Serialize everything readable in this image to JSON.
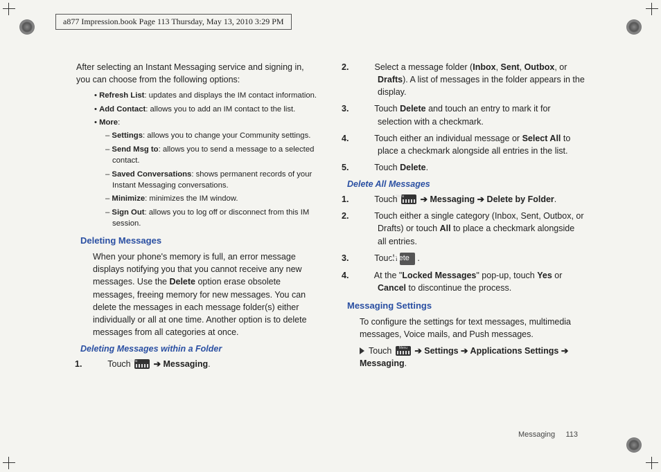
{
  "header": {
    "line": "a877 Impression.book  Page 113  Thursday, May 13, 2010  3:29 PM"
  },
  "footer": {
    "section": "Messaging",
    "page": "113"
  },
  "intro": "After selecting an Instant Messaging service and signing in, you can choose from the following options:",
  "bullets": {
    "refresh_b": "Refresh List",
    "refresh_t": ": updates and displays the IM contact information.",
    "addc_b": "Add Contact",
    "addc_t": ": allows you to add an IM contact to the list.",
    "more_b": "More",
    "more_t": ":"
  },
  "dashes": {
    "settings_b": "Settings",
    "settings_t": ": allows you to change your Community settings.",
    "sendmsg_b": "Send Msg to",
    "sendmsg_t": ": allows you to send a message to a selected contact.",
    "saved_b": "Saved Conversations",
    "saved_t": ": shows permanent records of your Instant Messaging conversations.",
    "min_b": "Minimize",
    "min_t": ": minimizes the IM window.",
    "signout_b": "Sign Out",
    "signout_t": ": allows you to log off or disconnect from this IM session."
  },
  "delmsg": {
    "h": "Deleting Messages",
    "p": "When your phone's memory is full, an error message displays notifying you that you cannot receive any new messages. Use the ",
    "p_b": "Delete",
    "p2": " option erase obsolete messages, freeing memory for new messages. You can delete the messages in each message folder(s) either individually or all at one time. Another option is to delete messages from all categories at once."
  },
  "delfolder": {
    "h": "Deleting Messages within a Folder",
    "s1a": "Touch ",
    "s1b": "Messaging",
    "s1c": ".",
    "s2a": "Select a message folder (",
    "s2b": "Inbox",
    "s2c": ", ",
    "s2d": "Sent",
    "s2e": ", ",
    "s2f": "Outbox",
    "s2g": ", or ",
    "s2h": "Drafts",
    "s2i": "). A list of messages in the folder appears in the display.",
    "s3a": "Touch ",
    "s3b": "Delete",
    "s3c": " and touch an entry to mark it for selection with a checkmark.",
    "s4a": "Touch either an individual message or ",
    "s4b": "Select All",
    "s4c": " to place a checkmark alongside all entries in the list.",
    "s5a": "Touch ",
    "s5b": "Delete",
    "s5c": "."
  },
  "delall": {
    "h": "Delete All Messages",
    "s1a": "Touch ",
    "s1b": "Messaging",
    "s1c": "Delete by Folder",
    "s1d": ".",
    "s2a": "Touch either a single category (Inbox, Sent, Outbox, or Drafts) or touch ",
    "s2b": "All",
    "s2c": " to place a checkmark alongside all entries.",
    "s3a": "Touch ",
    "s3b": "Delete",
    "s3c": ".",
    "s4a": "At the \"",
    "s4b": "Locked Messages",
    "s4c": "\" pop-up, touch ",
    "s4d": "Yes",
    "s4e": " or ",
    "s4f": "Cancel",
    "s4g": " to discontinue the process."
  },
  "msgset": {
    "h": "Messaging Settings",
    "p": "To configure the settings for text messages, multimedia messages, Voice mails, and Push messages.",
    "s1a": "Touch ",
    "s1b": "Settings",
    "s1c": "Applications Settings",
    "s1d": "Messaging",
    "s1e": "."
  },
  "arrow": " ➔ "
}
